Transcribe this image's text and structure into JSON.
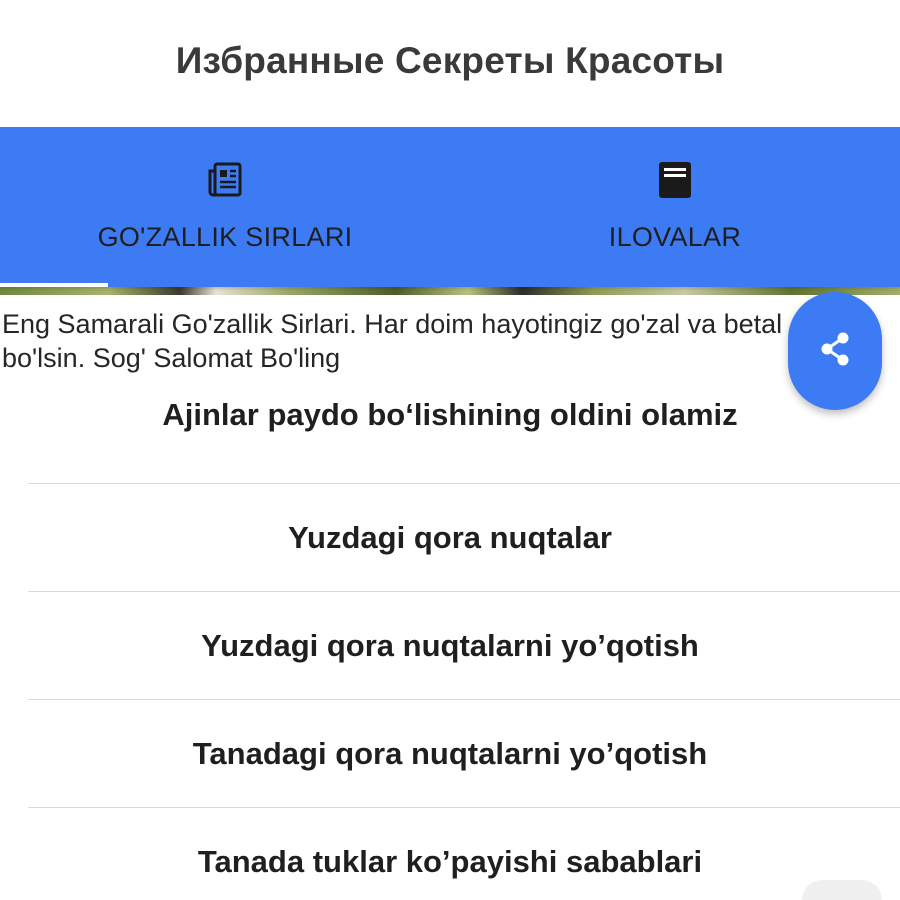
{
  "header": {
    "title": "Избранные Секреты Красоты"
  },
  "tabs": [
    {
      "label": "GO'ZALLIK SIRLARI",
      "icon": "newspaper-icon",
      "selected": true
    },
    {
      "label": "ILOVALAR",
      "icon": "document-icon",
      "selected": false
    }
  ],
  "intro": {
    "line1": "Eng Samarali Go'zallik Sirlari. Har doim hayotingiz go'zal va betal",
    "line2": "bo'lsin. Sog' Salomat Bo'ling"
  },
  "fab": {
    "icon": "share-icon"
  },
  "articles": [
    {
      "title": "Ajinlar paydo bo‘lishining oldini olamiz"
    },
    {
      "title": "Yuzdagi qora nuqtalar"
    },
    {
      "title": "Yuzdagi qora nuqtalarni yo’qotish"
    },
    {
      "title": "Tanadagi qora nuqtalarni yo’qotish"
    },
    {
      "title": "Tanada tuklar ko’payishi sabablari"
    }
  ],
  "colors": {
    "accent": "#3d7bf5",
    "tab_text": "#1e1e1e",
    "indicator": "#ffffff"
  }
}
